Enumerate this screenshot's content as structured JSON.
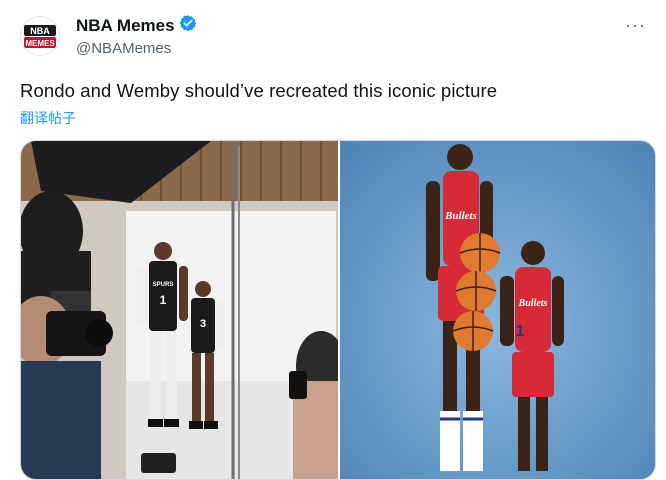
{
  "tweet": {
    "author": {
      "display_name": "NBA Memes",
      "handle": "@NBAMemes",
      "avatar_text_top": "NBA",
      "avatar_text_bottom": "MEMES",
      "verified_icon": "verified-badge-icon",
      "verified_color": "#1d9bf0"
    },
    "more_label": "···",
    "text": "Rondo and Wemby should’ve recreated this iconic picture",
    "translate_label": "翻译帖子",
    "media": [
      {
        "kind": "photo",
        "description_icon": "photo-shoot-image",
        "jersey_numbers": [
          "1",
          "3"
        ],
        "jersey_text": "SPURS"
      },
      {
        "kind": "photo",
        "description_icon": "bullets-players-image",
        "jersey_numbers": [
          "1"
        ],
        "jersey_text": "Bullets"
      }
    ]
  },
  "colors": {
    "accent": "#1d9bf0",
    "text": "#0f1419",
    "secondary": "#536471"
  }
}
